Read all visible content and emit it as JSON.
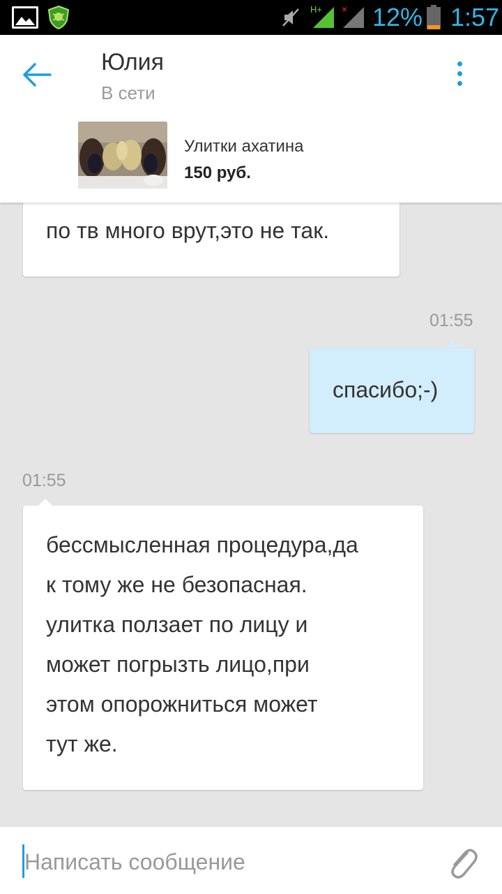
{
  "status_bar": {
    "battery": "12%",
    "time": "1:57",
    "icons": [
      "gallery-icon",
      "shield-icon",
      "mute-icon",
      "signal-h-plus-icon",
      "signal-no-sim-icon",
      "battery-icon"
    ],
    "accent_color": "#33b5e5"
  },
  "header": {
    "name": "Юлия",
    "status": "В сети",
    "product": {
      "title": "Улитки ахатина",
      "price": "150 руб."
    }
  },
  "messages": [
    {
      "direction": "incoming",
      "text": "по тв много врут,это не так."
    },
    {
      "direction": "outgoing",
      "time": "01:55",
      "text": "спасибо;-)"
    },
    {
      "direction": "incoming",
      "time": "01:55",
      "text": "бессмысленная процедура,да\nк тому же не безопасная.\nулитка ползает по лицу и\nможет погрызть лицо,при\nэтом опорожниться может\nтут же."
    }
  ],
  "composer": {
    "placeholder": "Написать сообщение"
  },
  "colors": {
    "outgoing_bubble": "#d2edfb",
    "incoming_bubble": "#ffffff",
    "chat_background": "#e5e5e5",
    "accent": "#1e9be9"
  }
}
